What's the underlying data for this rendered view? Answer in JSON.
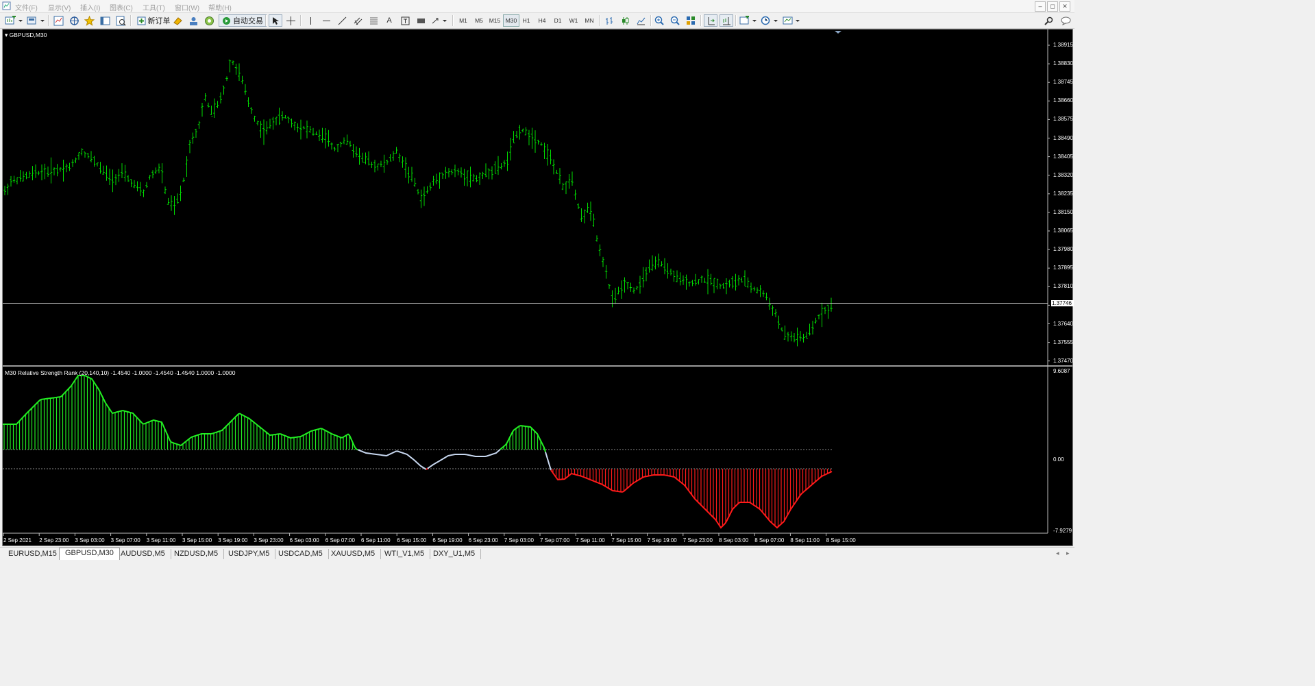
{
  "menu": [
    "文件(F)",
    "显示(V)",
    "插入(I)",
    "图表(C)",
    "工具(T)",
    "窗口(W)",
    "帮助(H)"
  ],
  "window_buttons": [
    "–",
    "◻",
    "✕"
  ],
  "toolbar": {
    "new_order": "新订单",
    "auto_trading": "自动交易",
    "timeframes": [
      "M1",
      "M5",
      "M15",
      "M30",
      "H1",
      "H4",
      "D1",
      "W1",
      "MN"
    ],
    "active_timeframe": "M30"
  },
  "chart": {
    "title": "GBPUSD,M30",
    "price_labels": [
      "1.38915",
      "1.38830",
      "1.38745",
      "1.38660",
      "1.38575",
      "1.38490",
      "1.38405",
      "1.38320",
      "1.38235",
      "1.38150",
      "1.38065",
      "1.37980",
      "1.37895",
      "1.37810",
      "1.37725",
      "1.37640",
      "1.37555",
      "1.37470"
    ],
    "current_price": "1.37746",
    "up_color": "#00dd00",
    "line_color": "#c0c0c0"
  },
  "indicator": {
    "title": "M30 Relative Strength Rank (20,140,10) -1.4540 -1.0000 -1.4540 -1.4540 1.0000 -1.0000",
    "max_label": "9.6087",
    "zero_label": "0.00",
    "min_label": "-7.9279",
    "positive_color": "#22ee22",
    "negative_color": "#ff1a1a",
    "neutral_color": "#c8d8f0"
  },
  "time_labels": [
    "2 Sep 2021",
    "2 Sep 23:00",
    "3 Sep 03:00",
    "3 Sep 07:00",
    "3 Sep 11:00",
    "3 Sep 15:00",
    "3 Sep 19:00",
    "3 Sep 23:00",
    "6 Sep 03:00",
    "6 Sep 07:00",
    "6 Sep 11:00",
    "6 Sep 15:00",
    "6 Sep 19:00",
    "6 Sep 23:00",
    "7 Sep 03:00",
    "7 Sep 07:00",
    "7 Sep 11:00",
    "7 Sep 15:00",
    "7 Sep 19:00",
    "7 Sep 23:00",
    "8 Sep 03:00",
    "8 Sep 07:00",
    "8 Sep 11:00",
    "8 Sep 15:00"
  ],
  "tabs": [
    "EURUSD,M15",
    "GBPUSD,M30",
    "AUDUSD,M5",
    "NZDUSD,M5",
    "USDJPY,M5",
    "USDCAD,M5",
    "XAUUSD,M5",
    "WTI_V1,M5",
    "DXY_U1,M5"
  ],
  "active_tab": "GBPUSD,M30",
  "tab_nav": [
    "◂",
    "▸"
  ]
}
